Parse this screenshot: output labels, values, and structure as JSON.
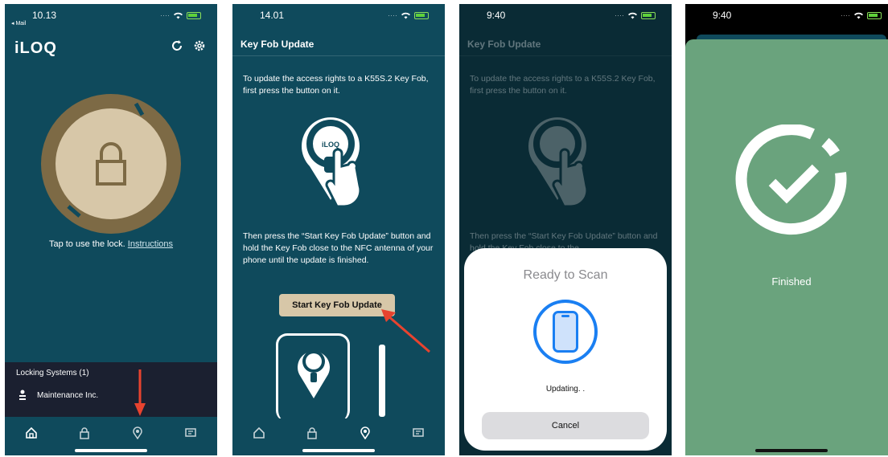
{
  "screen1": {
    "status_time": "10.13",
    "back_label": "◂ Mail",
    "app_logo": "iLOQ",
    "tap_text": "Tap to use the lock.",
    "instructions_link": "Instructions",
    "locking_systems_title": "Locking Systems (1)",
    "organization": "Maintenance Inc."
  },
  "screen2": {
    "status_time": "14.01",
    "title": "Key Fob Update",
    "instruction1": "To update the access rights to a K55S.2 Key Fob, first press the button on it.",
    "instruction2": "Then press the “Start Key Fob Update” button and hold the Key Fob close to the NFC antenna of your phone until the update is finished.",
    "start_button": "Start Key Fob Update",
    "fob_logo": "iLOQ"
  },
  "screen3": {
    "status_time": "9:40",
    "title": "Key Fob Update",
    "instruction1": "To update the access rights to a K55S.2 Key Fob, first press the button on it.",
    "instruction2": "Then press the “Start Key Fob Update” button and hold the Key Fob close to the",
    "ready_text": "Ready to Scan",
    "updating_text": "Updating. .",
    "cancel_button": "Cancel"
  },
  "screen4": {
    "status_time": "9:40",
    "finished_text": "Finished"
  },
  "colors": {
    "app_teal": "#0f4a5c",
    "lock_gold": "#7d6a45",
    "accent_beige": "#d7c7a8",
    "arrow_red": "#e8432f",
    "nfc_blue": "#1a7ff2",
    "success_green": "#6aa37d"
  },
  "icons": [
    "refresh-icon",
    "gear-icon",
    "padlock-icon",
    "home-icon",
    "lock-icon",
    "keyfob-icon",
    "messages-icon",
    "hand-press-icon",
    "phone-scan-icon",
    "checkmark-icon"
  ]
}
